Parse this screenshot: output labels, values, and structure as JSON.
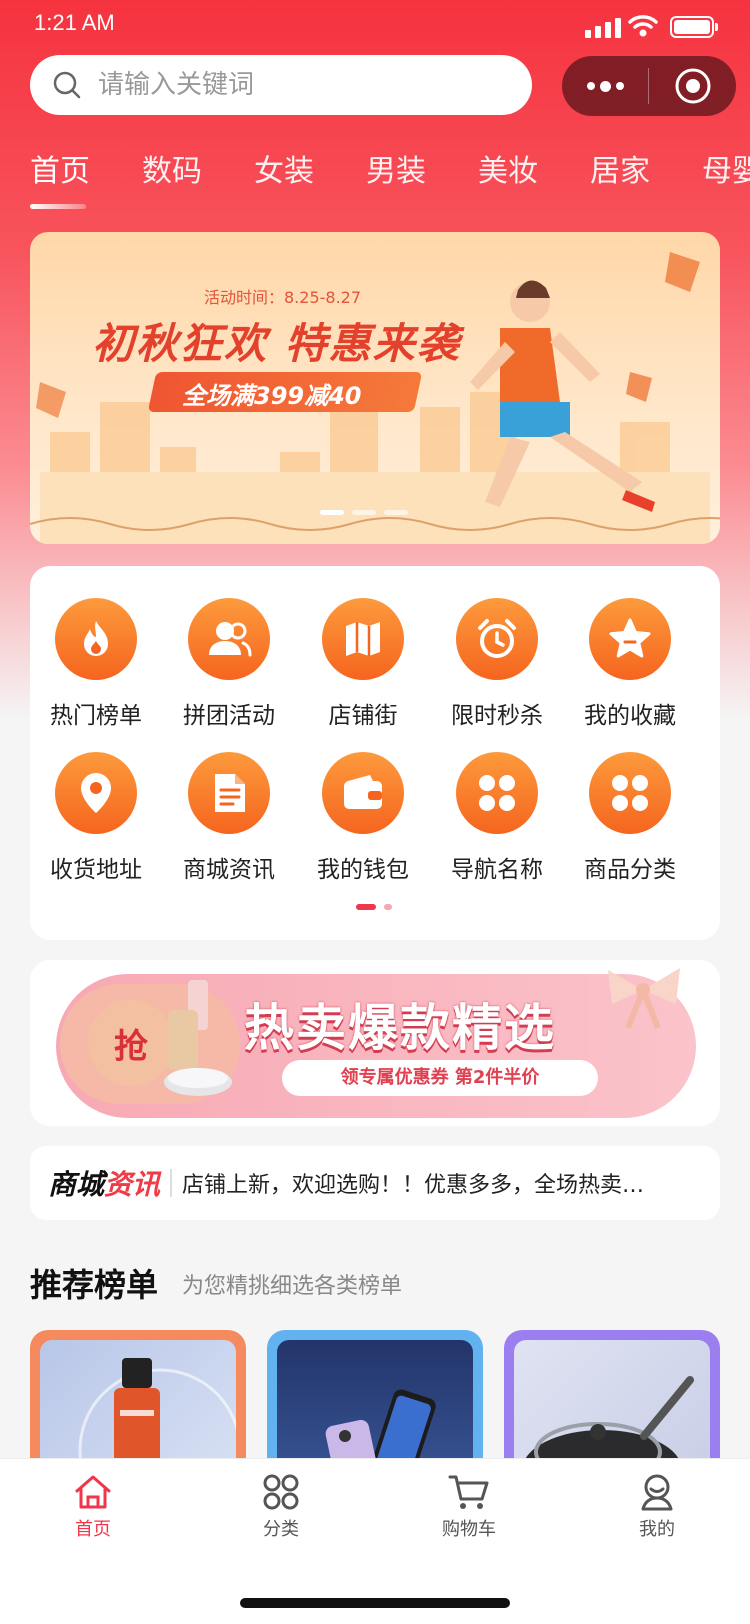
{
  "status": {
    "time": "1:21 AM"
  },
  "search": {
    "placeholder": "请输入关键词"
  },
  "tabs": [
    "首页",
    "数码",
    "女装",
    "男装",
    "美妆",
    "居家",
    "母婴"
  ],
  "banner": {
    "period": "活动时间：8.25-8.27",
    "headline": "初秋狂欢 特惠来袭",
    "offer": "全场满399减40"
  },
  "nav": [
    {
      "label": "热门榜单",
      "icon": "fire-icon"
    },
    {
      "label": "拼团活动",
      "icon": "group-icon"
    },
    {
      "label": "店铺街",
      "icon": "map-icon"
    },
    {
      "label": "限时秒杀",
      "icon": "alarm-clock-icon"
    },
    {
      "label": "我的收藏",
      "icon": "star-icon"
    },
    {
      "label": "收货地址",
      "icon": "location-pin-icon"
    },
    {
      "label": "商城资讯",
      "icon": "document-icon"
    },
    {
      "label": "我的钱包",
      "icon": "wallet-icon"
    },
    {
      "label": "导航名称",
      "icon": "grid-icon"
    },
    {
      "label": "商品分类",
      "icon": "grid-icon"
    }
  ],
  "promo": {
    "grab": "抢",
    "title": "热卖爆款精选",
    "subtitle": "领专属优惠券 第2件半价"
  },
  "news": {
    "brand_a": "商城",
    "brand_b": "资讯",
    "text": "店铺上新，欢迎选购！！优惠多多，全场热卖…"
  },
  "recommend": {
    "title": "推荐榜单",
    "subtitle": "为您精挑细选各类榜单"
  },
  "tabbar": [
    {
      "label": "首页",
      "icon": "home-icon",
      "active": true
    },
    {
      "label": "分类",
      "icon": "category-icon"
    },
    {
      "label": "购物车",
      "icon": "cart-icon"
    },
    {
      "label": "我的",
      "icon": "profile-icon"
    }
  ],
  "colors": {
    "brand_red": "#f0364a",
    "nav_orange": "#f5651f"
  }
}
